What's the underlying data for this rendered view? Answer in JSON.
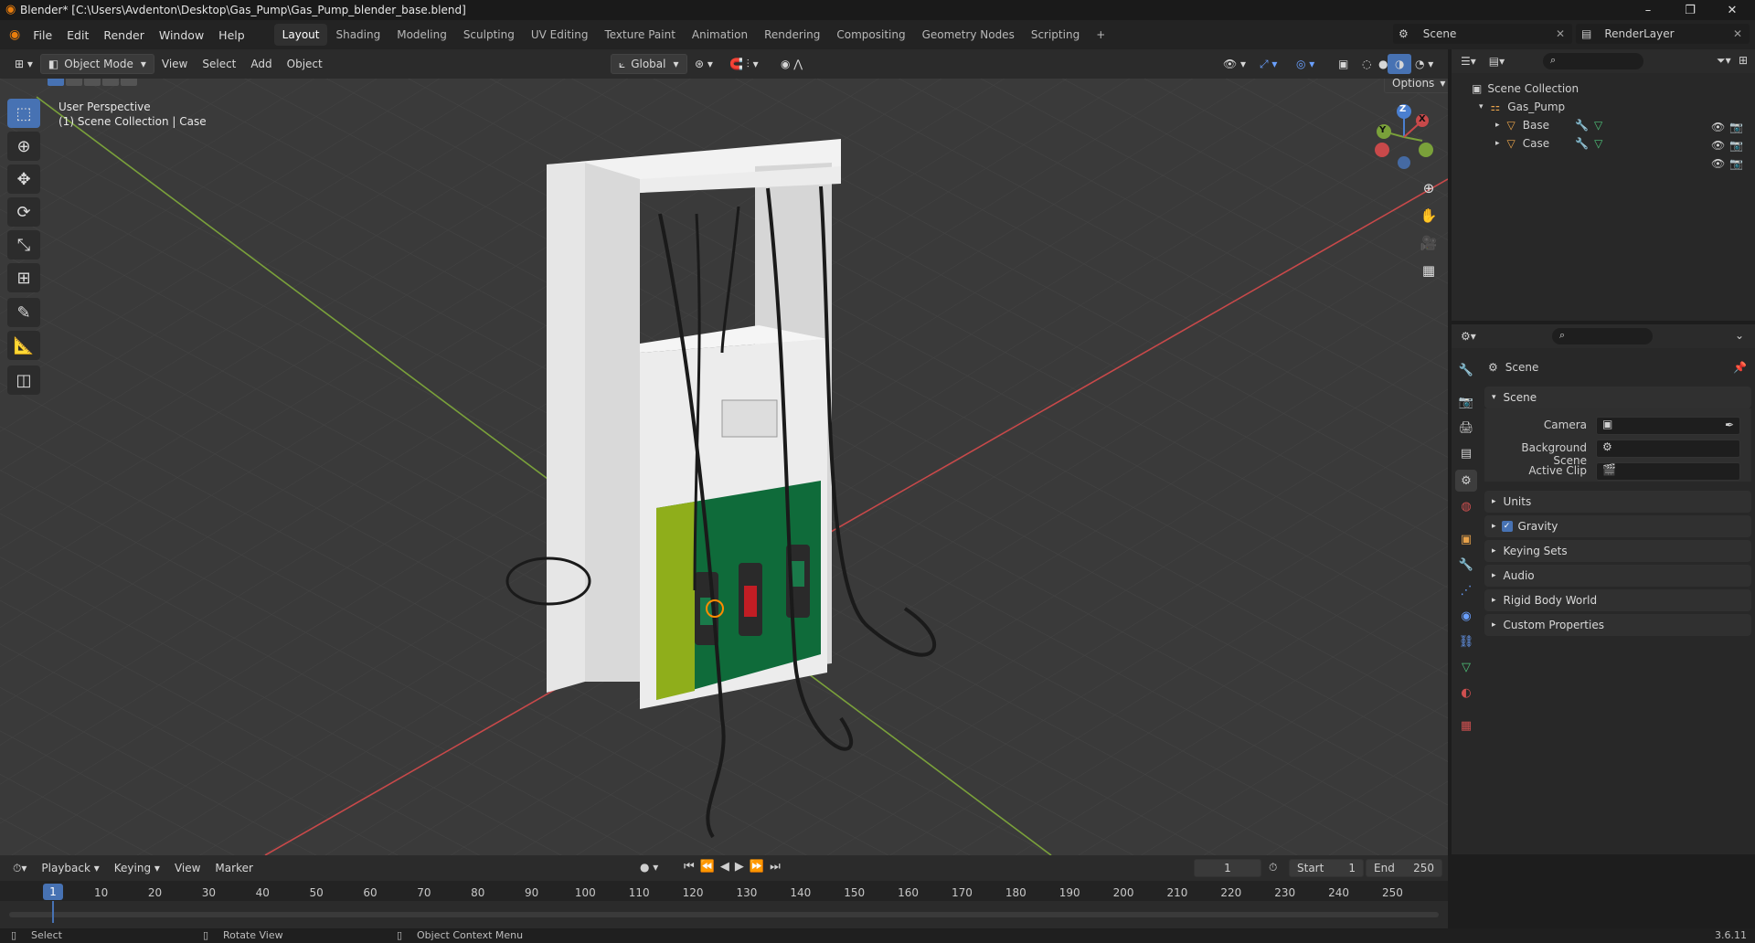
{
  "window": {
    "title": "Blender* [C:\\Users\\Avdenton\\Desktop\\Gas_Pump\\Gas_Pump_blender_base.blend]",
    "controls": [
      "–",
      "❐",
      "✕"
    ]
  },
  "menu": [
    "File",
    "Edit",
    "Render",
    "Window",
    "Help"
  ],
  "workspaces": [
    "Layout",
    "Shading",
    "Modeling",
    "Sculpting",
    "UV Editing",
    "Texture Paint",
    "Animation",
    "Rendering",
    "Compositing",
    "Geometry Nodes",
    "Scripting"
  ],
  "active_workspace": "Layout",
  "top_right": {
    "scene": "Scene",
    "view_layer": "RenderLayer"
  },
  "viewport_header": {
    "mode": "Object Mode",
    "menus": [
      "View",
      "Select",
      "Add",
      "Object"
    ],
    "orientation": "Global",
    "options": "Options"
  },
  "viewport": {
    "perspective": "User Perspective",
    "collection_info": "(1) Scene Collection | Case",
    "gizmo": {
      "x": "X",
      "y": "Y",
      "z": "Z"
    }
  },
  "outliner": {
    "root": "Scene Collection",
    "items": [
      {
        "name": "Gas_Pump",
        "level": 1
      },
      {
        "name": "Base",
        "level": 2
      },
      {
        "name": "Case",
        "level": 2
      }
    ]
  },
  "properties": {
    "context": "Scene",
    "section": "Scene",
    "fields": [
      {
        "label": "Camera",
        "value": ""
      },
      {
        "label": "Background Scene",
        "value": ""
      },
      {
        "label": "Active Clip",
        "value": ""
      }
    ],
    "panels": [
      "Units",
      "Gravity",
      "Keying Sets",
      "Audio",
      "Rigid Body World",
      "Custom Properties"
    ],
    "gravity_checked": true
  },
  "timeline": {
    "menus": [
      "Playback",
      "Keying",
      "View",
      "Marker"
    ],
    "current_frame": "1",
    "start_label": "Start",
    "start": "1",
    "end_label": "End",
    "end": "250",
    "ticks": [
      "1",
      "10",
      "20",
      "30",
      "40",
      "50",
      "60",
      "70",
      "80",
      "90",
      "100",
      "110",
      "120",
      "130",
      "140",
      "150",
      "160",
      "170",
      "180",
      "190",
      "200",
      "210",
      "220",
      "230",
      "240",
      "250"
    ]
  },
  "status": {
    "select": "Select",
    "rotate": "Rotate View",
    "context": "Object Context Menu",
    "version": "3.6.11"
  },
  "colors": {
    "accent": "#4772b3",
    "x_axis": "#c8494a",
    "y_axis": "#7aa13a",
    "z_axis": "#4a7fd0",
    "pump_green": "#0f6b3a"
  }
}
